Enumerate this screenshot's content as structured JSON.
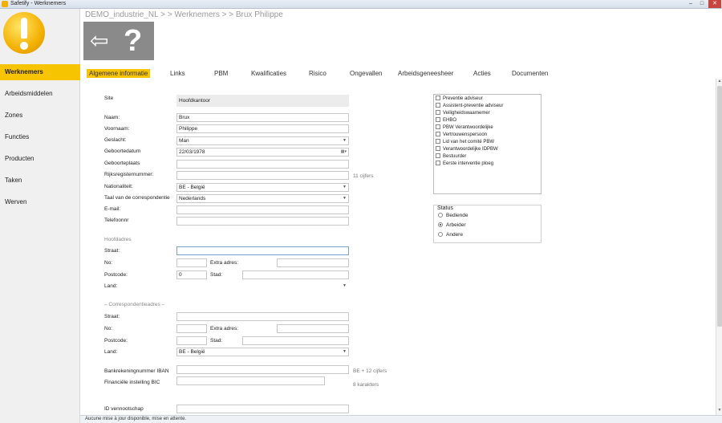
{
  "window": {
    "title": "Safetify - Werknemers",
    "minimize": "–",
    "maximize": "□",
    "close": "✕"
  },
  "sidebar": {
    "items": [
      {
        "label": "Werknemers"
      },
      {
        "label": "Arbeidsmiddelen"
      },
      {
        "label": "Zones"
      },
      {
        "label": "Functies"
      },
      {
        "label": "Producten"
      },
      {
        "label": "Taken"
      },
      {
        "label": "Werven"
      }
    ]
  },
  "breadcrumb": "DEMO_industrie_NL > > Werknemers > > Brux Philippe",
  "toolbar": {
    "back_icon": "⇦",
    "help_icon": "?"
  },
  "tabs": [
    {
      "label": "Algemene informatie"
    },
    {
      "label": "Links"
    },
    {
      "label": "PBM"
    },
    {
      "label": "Kwalificaties"
    },
    {
      "label": "Risico"
    },
    {
      "label": "Ongevallen"
    },
    {
      "label": "Arbeidsgeneesheer"
    },
    {
      "label": "Acties"
    },
    {
      "label": "Documenten"
    }
  ],
  "form": {
    "site": {
      "label": "Site",
      "value": "Hoofdkantoor"
    },
    "naam": {
      "label": "Naam:",
      "value": "Brux"
    },
    "voornaam": {
      "label": "Voornaam:",
      "value": "Philippe"
    },
    "geslacht": {
      "label": "Geslacht:",
      "value": "Man"
    },
    "geboortedatum": {
      "label": "Geboortedatum",
      "value": "22/03/1978"
    },
    "geboorteplaats": {
      "label": "Geboorteplaats",
      "value": ""
    },
    "rijksregister": {
      "label": "Rijksregisternummer:",
      "value": "",
      "hint": "11 cijfers"
    },
    "nationaliteit": {
      "label": "Nationaliteit:",
      "value": "BE - België"
    },
    "taal": {
      "label": "Taal van de correspondentie",
      "value": "Nederlands"
    },
    "email": {
      "label": "E-mail:",
      "value": ""
    },
    "telefoon": {
      "label": "Telefoonnr",
      "value": ""
    },
    "hoofdadres": {
      "title": "Hoofdadres",
      "straat": {
        "label": "Straat:",
        "value": ""
      },
      "no": {
        "label": "No:",
        "value": ""
      },
      "extra": {
        "label": "Extra adres:",
        "value": ""
      },
      "postcode": {
        "label": "Postcode:",
        "value": "0"
      },
      "stad": {
        "label": "Stad:",
        "value": ""
      },
      "land": {
        "label": "Land:",
        "value": ""
      }
    },
    "correspondentie": {
      "title": "– Correspondentieadres –",
      "straat": {
        "label": "Straat:",
        "value": ""
      },
      "no": {
        "label": "No:",
        "value": ""
      },
      "extra": {
        "label": "Extra adres:",
        "value": ""
      },
      "postcode": {
        "label": "Postcode:",
        "value": ""
      },
      "stad": {
        "label": "Stad:",
        "value": ""
      },
      "land": {
        "label": "Land:",
        "value": "BE - België"
      }
    },
    "iban": {
      "label": "Bankrekeningnummer IBAN",
      "value": "",
      "hint": "BE + 12 cijfers"
    },
    "bic": {
      "label": "Financiële instelling BIC",
      "value": "",
      "hint": "8 karakters"
    },
    "vennootschap": {
      "label": "ID vennootschap",
      "value": ""
    }
  },
  "roles": [
    "Preventie adviseur",
    "Assistent-preventie adviseur",
    "Veiligheidswaarnemer",
    "EHBO",
    "PBW Verantwoordelijke",
    "Vertrouwenspersoon",
    "Lid van het comité PBW",
    "Verantwoordelijke IDPBW",
    "Bestuurder",
    "Eerste interventie ploeg"
  ],
  "status": {
    "title": "Status",
    "options": [
      {
        "label": "Bediende",
        "selected": false
      },
      {
        "label": "Arbeider",
        "selected": true
      },
      {
        "label": "Andere",
        "selected": false
      }
    ]
  },
  "statusbar": "Aucune mise à jour disponible, mise en attente.",
  "colors": {
    "accent": "#f6c400",
    "sidebar_bg": "#f0f0f0",
    "tile": "#8a8a8a"
  }
}
